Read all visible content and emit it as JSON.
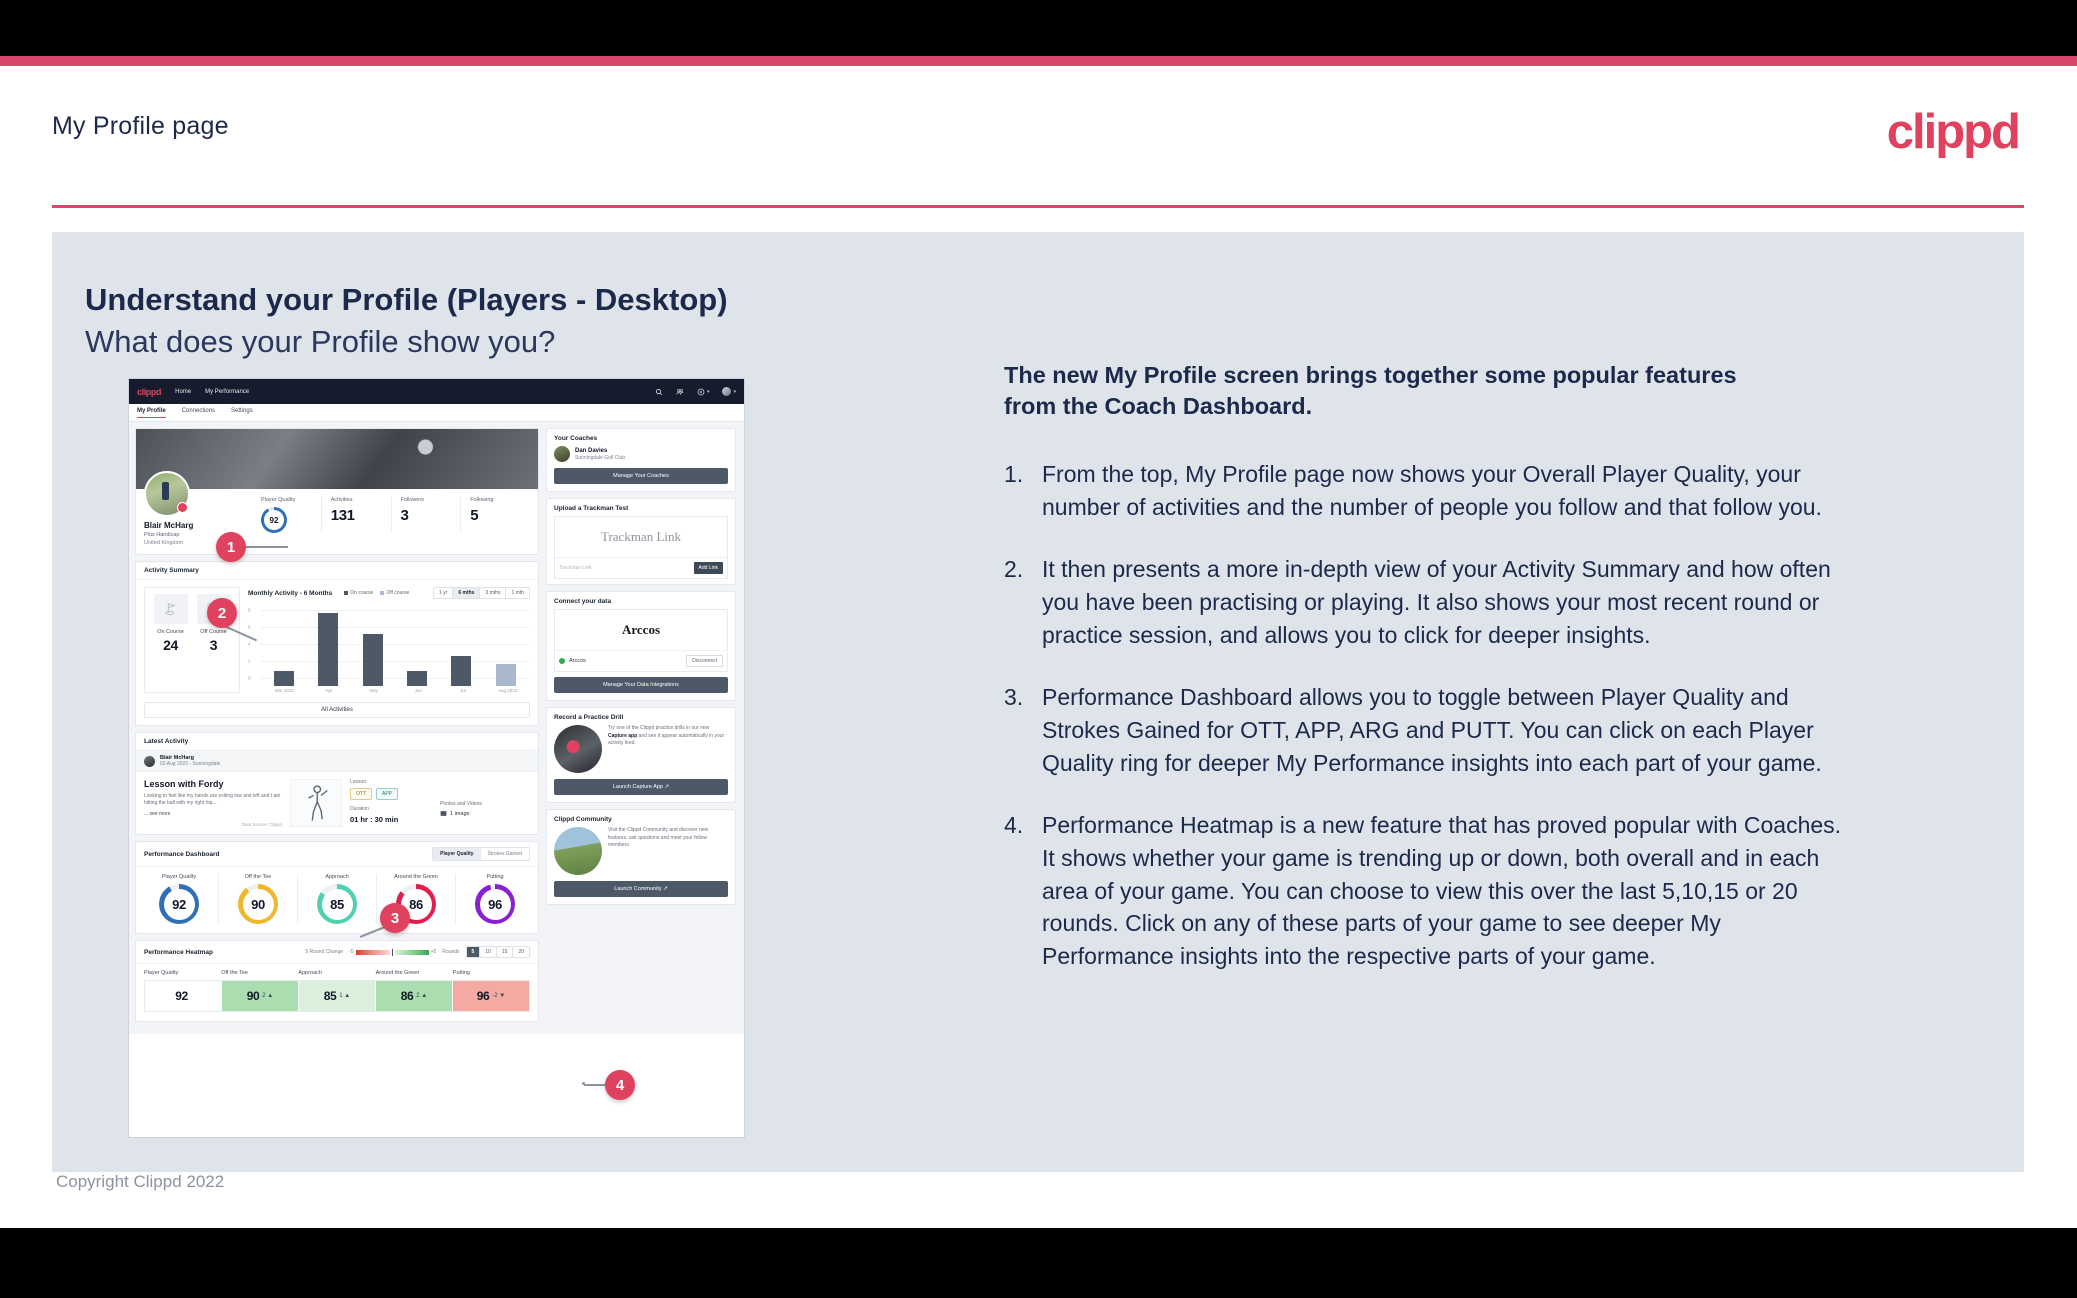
{
  "header": {
    "title": "My Profile page",
    "logo": "clippd"
  },
  "slide": {
    "heading": "Understand your Profile (Players - Desktop)",
    "subheading": "What does your Profile show you?",
    "lead": "The new My Profile screen brings together some popular features from the Coach Dashboard.",
    "points": [
      {
        "num": "1.",
        "text": "From the top, My Profile page now shows your Overall Player Quality, your number of activities and the number of people you follow and that follow you."
      },
      {
        "num": "2.",
        "text": "It then presents a more in-depth view of your Activity Summary and how often you have been practising or playing. It also shows your most recent round or practice session, and allows you to click for deeper insights."
      },
      {
        "num": "3.",
        "text": "Performance Dashboard allows you to toggle between Player Quality and Strokes Gained for OTT, APP, ARG and PUTT. You can click on each Player Quality ring for deeper My Performance insights into each part of your game."
      },
      {
        "num": "4.",
        "text": "Performance Heatmap is a new feature that has proved popular with Coaches. It shows whether your game is trending up or down, both overall and in each area of your game. You can choose to view this over the last 5,10,15 or 20 rounds. Click on any of these parts of your game to see deeper My Performance insights into the respective parts of your game."
      }
    ],
    "callouts": [
      "1",
      "2",
      "3",
      "4"
    ]
  },
  "copyright": "Copyright Clippd 2022",
  "app": {
    "nav": {
      "logo": "clippd",
      "links": [
        "Home",
        "My Performance"
      ],
      "icons": [
        "search-icon",
        "people-icon",
        "add-circle-icon",
        "avatar-icon"
      ]
    },
    "tabs": [
      {
        "label": "My Profile",
        "active": true
      },
      {
        "label": "Connections",
        "active": false
      },
      {
        "label": "Settings",
        "active": false
      }
    ],
    "profile": {
      "name": "Blair McHarg",
      "handicap": "Plus Handicap",
      "location": "United Kingdom",
      "stats": [
        {
          "label": "Player Quality",
          "value": "92",
          "type": "ring"
        },
        {
          "label": "Activities",
          "value": "131",
          "type": "number"
        },
        {
          "label": "Followers",
          "value": "3",
          "type": "number"
        },
        {
          "label": "Following",
          "value": "5",
          "type": "number"
        }
      ]
    },
    "activity_summary": {
      "title": "Activity Summary",
      "on_course_label": "On Course",
      "on_course_value": "24",
      "off_course_label": "Off Course",
      "off_course_value": "3",
      "chart_title": "Monthly Activity - 6 Months",
      "legend": [
        {
          "label": "On course",
          "color": "#4e5967"
        },
        {
          "label": "Off course",
          "color": "#a9b8cd"
        }
      ],
      "ranges": [
        {
          "label": "1 yr",
          "active": false
        },
        {
          "label": "6 mths",
          "active": true
        },
        {
          "label": "3 mths",
          "active": false
        },
        {
          "label": "1 mth",
          "active": false
        }
      ],
      "all_activities": "All Activities"
    },
    "latest_activity": {
      "title": "Latest Activity",
      "user": "Blair McHarg",
      "date": "03 Aug 2022 - Sunningdale",
      "post_title": "Lesson with Fordy",
      "post_body": "Looking to feel like my hands are exiting low and left and I am hitting the ball with my right hip...",
      "see_more": "... see more",
      "data_source": "Data Source: Clippd",
      "lesson_label": "Lesson",
      "chips": [
        "OTT",
        "APP"
      ],
      "duration_label": "Duration",
      "duration_value": "01 hr : 30 min",
      "media_label": "Photos and Videos",
      "media_value": "1 image"
    },
    "performance_dashboard": {
      "title": "Performance Dashboard",
      "toggle": [
        {
          "label": "Player Quality",
          "active": true
        },
        {
          "label": "Strokes Gained",
          "active": false
        }
      ],
      "rings": [
        {
          "label": "Player Quality",
          "value": "92",
          "color": "#2f6fb5",
          "pct": 92
        },
        {
          "label": "Off the Tee",
          "value": "90",
          "color": "#edb72e",
          "pct": 90
        },
        {
          "label": "Approach",
          "value": "85",
          "color": "#4fd1b0",
          "pct": 85
        },
        {
          "label": "Around the Green",
          "value": "86",
          "color": "#e01f4e",
          "pct": 86
        },
        {
          "label": "Putting",
          "value": "96",
          "color": "#8b1fd6",
          "pct": 96
        }
      ]
    },
    "performance_heatmap": {
      "title": "Performance Heatmap",
      "change_label": "5 Round Change",
      "scale_min": "-5",
      "scale_max": "+5",
      "rounds_label": "Rounds",
      "rounds": [
        {
          "label": "5",
          "active": true
        },
        {
          "label": "10",
          "active": false
        },
        {
          "label": "15",
          "active": false
        },
        {
          "label": "20",
          "active": false
        }
      ],
      "cells": [
        {
          "label": "Player Quality",
          "value": "92",
          "delta": "",
          "bg": "#ffffff"
        },
        {
          "label": "Off the Tee",
          "value": "90",
          "delta": "2 ▲",
          "bg": "#aadeb0"
        },
        {
          "label": "Approach",
          "value": "85",
          "delta": "1 ▲",
          "bg": "#daf0dc"
        },
        {
          "label": "Around the Green",
          "value": "86",
          "delta": "2 ▲",
          "bg": "#aadeb0"
        },
        {
          "label": "Putting",
          "value": "96",
          "delta": "-2 ▼",
          "bg": "#f4a9a2"
        }
      ]
    },
    "sidebar": {
      "coaches": {
        "title": "Your Coaches",
        "coach_name": "Dan Davies",
        "coach_club": "Sunningdale Golf Club",
        "button": "Manage Your Coaches"
      },
      "trackman": {
        "title": "Upload a Trackman Test",
        "logo": "Trackman Link",
        "placeholder": "Trackman Link",
        "button": "Add Link"
      },
      "connect": {
        "title": "Connect your data",
        "logo": "Arccos",
        "provider": "Arccos",
        "disconnect": "Disconnect",
        "button": "Manage Your Data Integrations"
      },
      "practice": {
        "title": "Record a Practice Drill",
        "body_pre": "Try one of the Clippd practice drills in our new ",
        "body_bold": "Capture app",
        "body_post": " and see it appear automatically in your activity feed.",
        "button": "Launch Capture App ↗"
      },
      "community": {
        "title": "Clippd Community",
        "body": "Visit the Clippd Community and discover new features, ask questions and meet your fellow members.",
        "button": "Launch Community ↗"
      }
    }
  },
  "chart_data": {
    "type": "bar",
    "title": "Monthly Activity - 6 Months",
    "categories": [
      "Mar 2022",
      "Apr",
      "May",
      "Jun",
      "Jul",
      "Aug 2022"
    ],
    "series": [
      {
        "name": "On course",
        "values": [
          2,
          10,
          7,
          2,
          4,
          0
        ],
        "color": "#4e5967"
      },
      {
        "name": "Off course",
        "values": [
          0,
          0,
          0,
          0,
          0,
          3
        ],
        "color": "#a9b8cd"
      }
    ],
    "values": [
      2,
      10,
      7,
      2,
      4,
      3
    ],
    "bar_colors": [
      "#4e5967",
      "#4e5967",
      "#4e5967",
      "#4e5967",
      "#4e5967",
      "#a9b8cd"
    ],
    "yticks": [
      "0",
      "2",
      "4",
      "6",
      "8"
    ],
    "ylim": [
      0,
      10
    ],
    "xlabel": "",
    "ylabel": "",
    "grid": true,
    "legend_position": "top"
  }
}
